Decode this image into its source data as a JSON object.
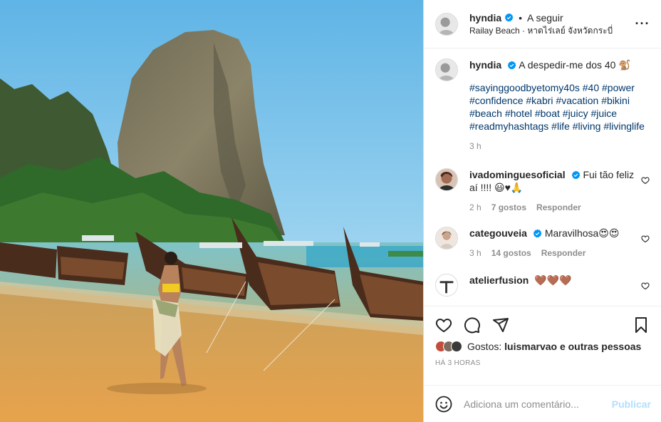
{
  "header": {
    "username": "hyndia",
    "follow_label": "A seguir",
    "location": "Railay Beach · หาดไร่เลย์ จังหวัดกระบี่"
  },
  "caption": {
    "username": "hyndia",
    "text": "A despedir-me dos 40 🐒",
    "hashtags": "#sayinggoodbyetomy40s #40 #power #confidence #kabri #vacation #bikini #beach #hotel #boat #juicy #juice #readmyhashtags #life #living #livinglife",
    "time": "3 h"
  },
  "comments": [
    {
      "username": "ivadominguesoficial",
      "text": "Fui tão feliz aí !!!! 😃♥🙏",
      "time": "2 h",
      "likes": "7 gostos",
      "reply": "Responder"
    },
    {
      "username": "categouveia",
      "text": "Maravilhosa😍😍",
      "time": "3 h",
      "likes": "14 gostos",
      "reply": "Responder"
    },
    {
      "username": "atelierfusion",
      "text": "🤎🤎🤎"
    }
  ],
  "likes": {
    "prefix": "Gostos: ",
    "bold": "luismarvao e outras pessoas"
  },
  "timestamp": "HÁ 3 HORAS",
  "add_comment": {
    "placeholder": "Adiciona um comentário...",
    "post_label": "Publicar"
  },
  "colors": {
    "verified": "#0095f6",
    "hashtag": "#00376b",
    "muted": "#8e8e8e",
    "post_disabled": "#b2dffc"
  },
  "icons": [
    "verified-icon",
    "more-icon",
    "heart-icon",
    "comment-icon",
    "share-icon",
    "save-icon",
    "emoji-icon"
  ]
}
